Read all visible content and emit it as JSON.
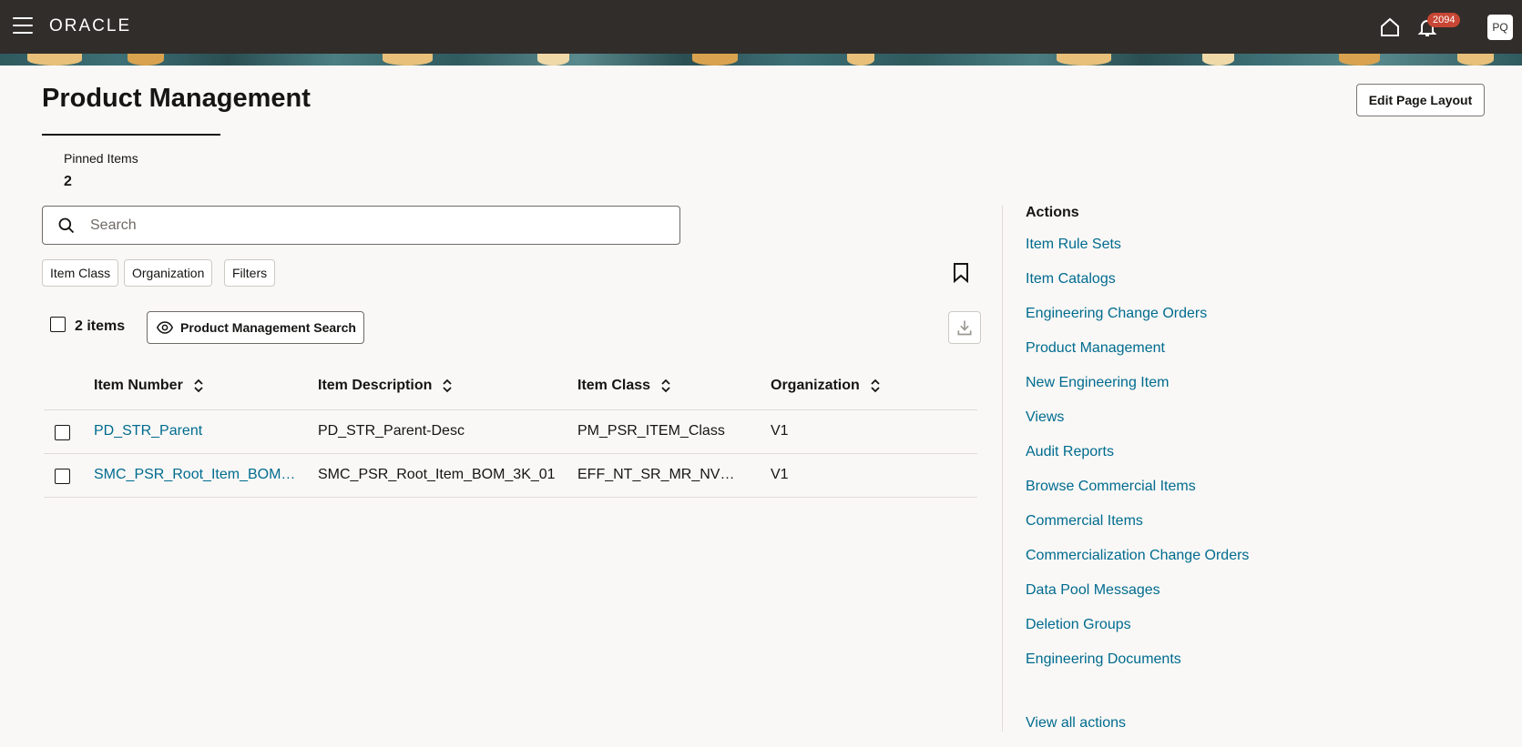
{
  "header": {
    "logo": "ORACLE",
    "notification_count": "2094",
    "user_initials": "PQ"
  },
  "page": {
    "title": "Product Management",
    "edit_layout_label": "Edit Page Layout",
    "pinned_label": "Pinned Items",
    "pinned_count": "2"
  },
  "search": {
    "placeholder": "Search",
    "value": ""
  },
  "filters": {
    "item_class": "Item Class",
    "organization": "Organization",
    "filters": "Filters"
  },
  "results": {
    "count_label": "2 items",
    "saved_search_label": "Product Management Search"
  },
  "table": {
    "columns": [
      "Item Number",
      "Item Description",
      "Item Class",
      "Organization"
    ],
    "rows": [
      [
        "PD_STR_Parent",
        "PD_STR_Parent-Desc",
        "PM_PSR_ITEM_Class",
        "V1"
      ],
      [
        "SMC_PSR_Root_Item_BOM…",
        "SMC_PSR_Root_Item_BOM_3K_01",
        "EFF_NT_SR_MR_NV_…",
        "V1"
      ]
    ]
  },
  "actions": {
    "title": "Actions",
    "items": [
      "Item Rule Sets",
      "Item Catalogs",
      "Engineering Change Orders",
      "Product Management",
      "New Engineering Item",
      "Views",
      "Audit Reports",
      "Browse Commercial Items",
      "Commercial Items",
      "Commercialization Change Orders",
      "Data Pool Messages",
      "Deletion Groups",
      "Engineering Documents"
    ],
    "view_all": "View all actions"
  },
  "colors": {
    "topbar": "#312d2a",
    "link": "#006b8f",
    "badge": "#c74634"
  }
}
